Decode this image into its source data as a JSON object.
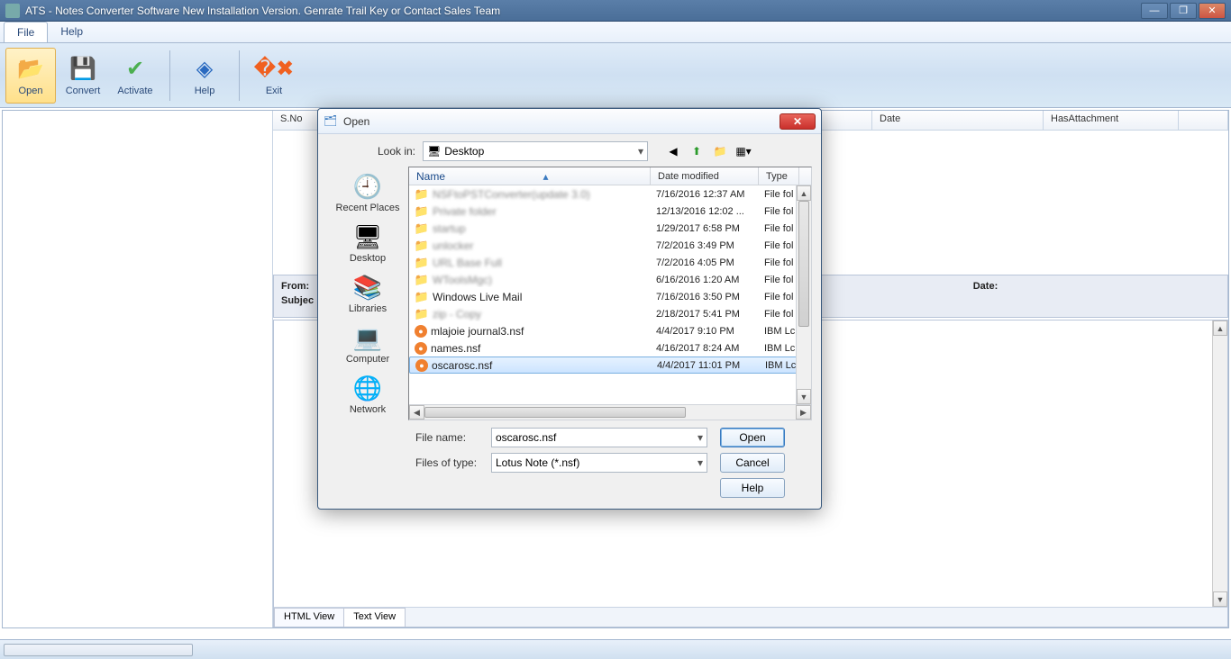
{
  "window": {
    "title": "ATS - Notes Converter Software New Installation Version. Genrate Trail Key or Contact Sales Team"
  },
  "menubar": {
    "file": "File",
    "help": "Help"
  },
  "ribbon": {
    "open": "Open",
    "convert": "Convert",
    "activate": "Activate",
    "help": "Help",
    "exit": "Exit"
  },
  "table": {
    "sno": "S.No",
    "date": "Date",
    "hasattach": "HasAttachment"
  },
  "details": {
    "from": "From:",
    "subject": "Subjec",
    "date": "Date:"
  },
  "viewer": {
    "html_tab": "HTML View",
    "text_tab": "Text View"
  },
  "dialog": {
    "title": "Open",
    "lookin_label": "Look in:",
    "lookin_value": "Desktop",
    "places": {
      "recent": "Recent Places",
      "desktop": "Desktop",
      "libraries": "Libraries",
      "computer": "Computer",
      "network": "Network"
    },
    "columns": {
      "name": "Name",
      "modified": "Date modified",
      "type": "Type"
    },
    "files": [
      {
        "icon": "folder",
        "name": "NSFtoPSTConverter(update 3.0)",
        "blur": true,
        "modified": "7/16/2016 12:37 AM",
        "type": "File fol"
      },
      {
        "icon": "folder",
        "name": "Private folder",
        "blur": true,
        "modified": "12/13/2016 12:02 ...",
        "type": "File fol"
      },
      {
        "icon": "folder",
        "name": "startup",
        "blur": true,
        "modified": "1/29/2017 6:58 PM",
        "type": "File fol"
      },
      {
        "icon": "folder",
        "name": "unlocker",
        "blur": true,
        "modified": "7/2/2016 3:49 PM",
        "type": "File fol"
      },
      {
        "icon": "folder",
        "name": "URL Base Full",
        "blur": true,
        "modified": "7/2/2016 4:05 PM",
        "type": "File fol"
      },
      {
        "icon": "folder",
        "name": "WToolsMgc)",
        "blur": true,
        "modified": "6/16/2016 1:20 AM",
        "type": "File fol"
      },
      {
        "icon": "folder",
        "name": "Windows Live Mail",
        "blur": false,
        "modified": "7/16/2016 3:50 PM",
        "type": "File fol"
      },
      {
        "icon": "folder",
        "name": "zip - Copy",
        "blur": true,
        "modified": "2/18/2017 5:41 PM",
        "type": "File fol"
      },
      {
        "icon": "nsf",
        "name": "mlajoie journal3.nsf",
        "blur": false,
        "modified": "4/4/2017 9:10 PM",
        "type": "IBM Lc"
      },
      {
        "icon": "nsf",
        "name": "names.nsf",
        "blur": false,
        "modified": "4/16/2017 8:24 AM",
        "type": "IBM Lc"
      },
      {
        "icon": "nsf",
        "name": "oscarosc.nsf",
        "blur": false,
        "modified": "4/4/2017 11:01 PM",
        "type": "IBM Lc",
        "selected": true
      }
    ],
    "filename_label": "File name:",
    "filename_value": "oscarosc.nsf",
    "filetype_label": "Files of type:",
    "filetype_value": "Lotus Note (*.nsf)",
    "open_btn": "Open",
    "cancel_btn": "Cancel",
    "help_btn": "Help"
  }
}
